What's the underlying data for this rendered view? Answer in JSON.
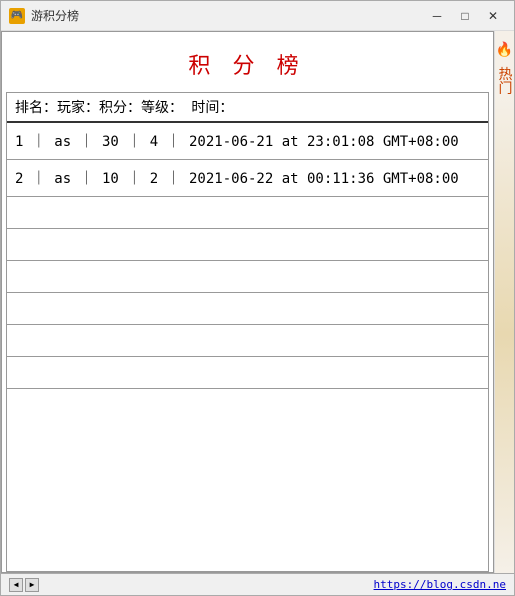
{
  "window": {
    "title": "游积分榜",
    "icon": "🔥"
  },
  "titlebar": {
    "minimize": "─",
    "maximize": "□",
    "close": "✕"
  },
  "leaderboard": {
    "title": "积 分 榜",
    "header": "排名：玩家：积分：等级：        时间：",
    "rows": [
      {
        "rank": "1",
        "player": "as",
        "score": "30",
        "level": "4",
        "time": "2021-06-21 at 23:01:08 GMT+08:00"
      },
      {
        "rank": "2",
        "player": "as",
        "score": "10",
        "level": "2",
        "time": "2021-06-22 at 00:11:36 GMT+08:00"
      }
    ]
  },
  "sidebar": {
    "label": "热门"
  },
  "bottom": {
    "url": "https://blog.csdn.ne"
  }
}
